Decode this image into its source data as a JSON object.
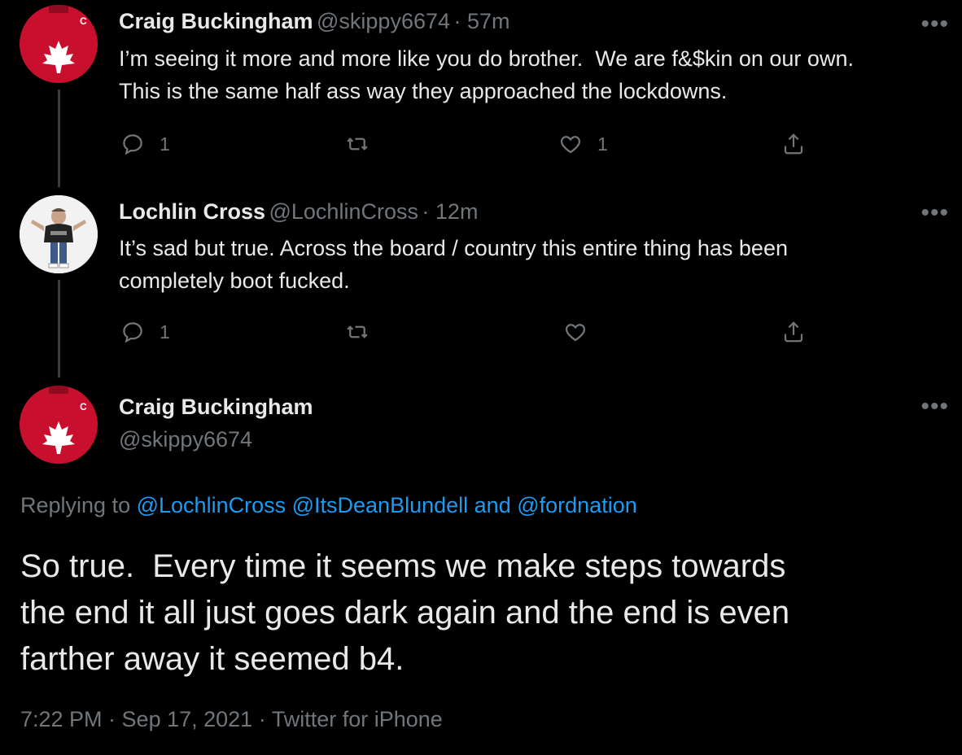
{
  "tweets": [
    {
      "name": "Craig Buckingham",
      "handle": "@skippy6674",
      "time": "· 57m",
      "text": "I’m seeing it more and more like you do brother.  We are f&$kin on our own.\nThis is the same half ass way they approached the lockdowns.",
      "replies": "1",
      "retweets": "",
      "likes": "1"
    },
    {
      "name": "Lochlin Cross",
      "handle": "@LochlinCross",
      "time": "· 12m",
      "text": "It’s sad but true. Across the board / country this entire thing has been\ncompletely boot fucked.",
      "replies": "1",
      "retweets": "",
      "likes": ""
    }
  ],
  "main_tweet": {
    "name": "Craig Buckingham",
    "handle": "@skippy6674",
    "replying_prefix": "Replying to",
    "mention_1": "@LochlinCross",
    "mention_2": "@ItsDeanBlundell",
    "and": "and",
    "mention_3": "@fordnation",
    "text": "So true.  Every time it seems we make steps towards\nthe end it all just goes dark again and the end is even\nfarther away it seemed b4.",
    "timestamp": "7:22 PM · Sep 17, 2021 · Twitter for iPhone"
  },
  "icons": {
    "more": "more-dots-icon",
    "reply": "reply-icon",
    "retweet": "retweet-icon",
    "like": "heart-icon",
    "share": "share-icon"
  },
  "colors": {
    "background": "#000000",
    "text": "#e7e9ea",
    "muted": "#71767b",
    "link": "#1d9bf0",
    "jersey": "#c8102e"
  }
}
